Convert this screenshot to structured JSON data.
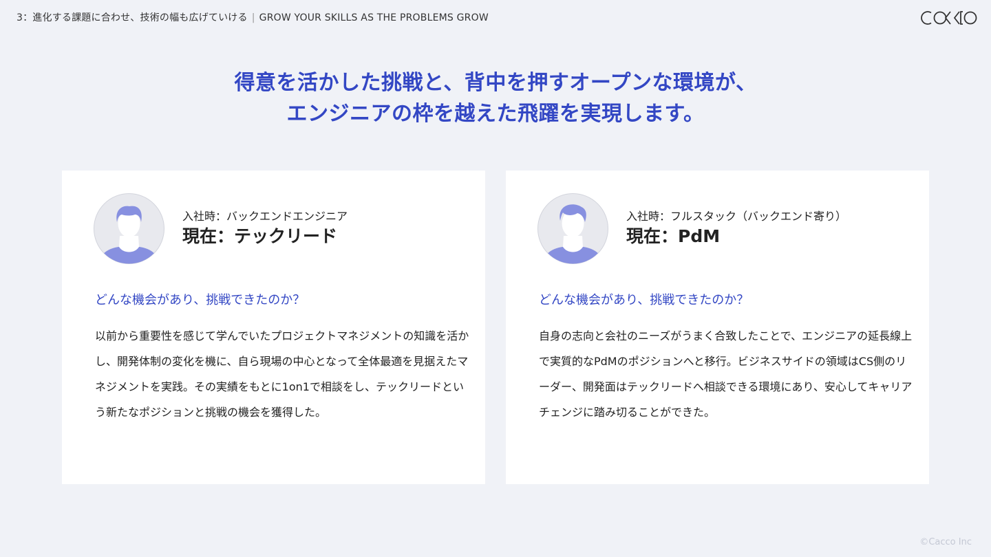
{
  "header": {
    "section_label": "3：進化する課題に合わせ、技術の幅も広げていける",
    "section_subtitle": "GROW YOUR SKILLS AS THE PROBLEMS GROW",
    "logo_text": "cacco"
  },
  "headline": {
    "line1": "得意を活かした挑戦と、背中を押すオープンな環境が、",
    "line2": "エンジニアの枠を越えた飛躍を実現します。"
  },
  "cards": [
    {
      "role_before": "入社時：バックエンドエンジニア",
      "role_now": "現在：テックリード",
      "question": "どんな機会があり、挑戦できたのか？",
      "body": "以前から重要性を感じて学んでいたプロジェクトマネジメントの知識を活かし、開発体制の変化を機に、自ら現場の中心となって全体最適を見据えたマネジメントを実践。その実績をもとに1on1で相談をし、テックリードという新たなポジションと挑戦の機会を獲得した。"
    },
    {
      "role_before": "入社時：フルスタック（バックエンド寄り）",
      "role_now": "現在：PdM",
      "question": "どんな機会があり、挑戦できたのか？",
      "body": "自身の志向と会社のニーズがうまく合致したことで、エンジニアの延長線上で実質的なPdMのポジションへと移行。ビジネスサイドの領域はCS側のリーダー、開発面はテックリードへ相談できる環境にあり、安心してキャリアチェンジに踏み切ることができた。"
    }
  ],
  "footer": {
    "copyright": "©Cacco Inc"
  },
  "colors": {
    "accent": "#3347c4",
    "background": "#f0f2f7",
    "avatar_figure": "#8790e0",
    "avatar_bg": "#e8e9ee"
  }
}
